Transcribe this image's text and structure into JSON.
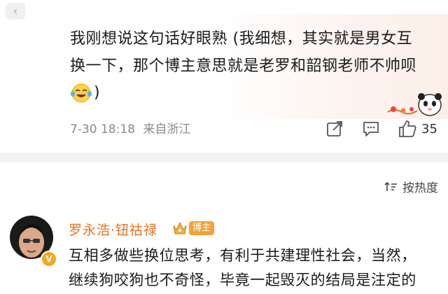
{
  "top_comment": {
    "line1": "我刚想说这句话好眼熟 (我细想，其实就是男女互",
    "line2": "换一下，那个博主意思就是老罗和韶钢老师不帅呗",
    "line3_suffix": ")",
    "emoji": "laugh-cry-emoji",
    "timestamp": "7-30 18:18",
    "location": "来自浙江",
    "like_count": "35"
  },
  "sort": {
    "label": "按热度"
  },
  "reply": {
    "username": "罗永浩·钮祜禄",
    "tag": "博主",
    "line1": "互相多做些换位思考，有利于共建理性社会，当然，",
    "line2": "继续狗咬狗也不奇怪，毕竟一起毁灭的结局是注定的",
    "verified": "V"
  },
  "colors": {
    "username": "#e8731d",
    "tag_bg": "#f4a23a",
    "divider": "#f2f2f2"
  }
}
